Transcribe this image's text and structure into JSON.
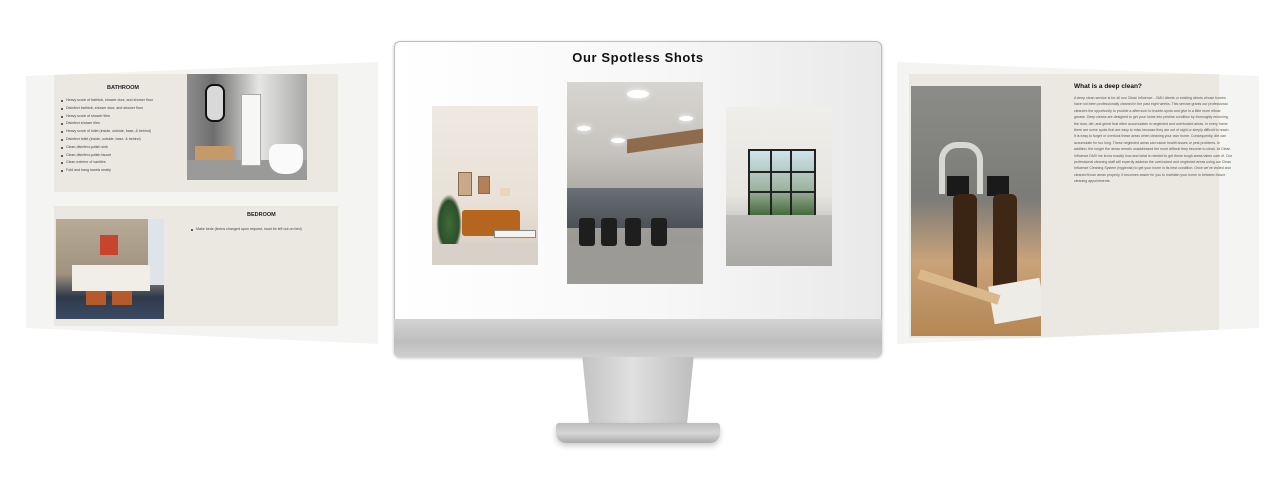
{
  "left_panel": {
    "bathroom": {
      "title": "BATHROOM",
      "items": [
        "Heavy scrub of bathtub, shower door, and shower floor",
        "Disinfect bathtub, shower door, and shower floor",
        "Heavy scrub of shower tiles",
        "Disinfect shower tiles",
        "Heavy scrub of toilet (inside, outside, base, & behind)",
        "Disinfect toilet (inside, outside, base, & behind)",
        "Clean-disinfect-polish sink",
        "Clean-disinfect-polish faucet",
        "Clean exterior of vanities",
        "Fold and hang towels neatly"
      ]
    },
    "bedroom": {
      "title": "BEDROOM",
      "items": [
        "Make beds (linens changed upon request, must be left out on bed)"
      ]
    }
  },
  "monitor": {
    "title": "Our Spotless Shots"
  },
  "right_panel": {
    "heading": "What is a deep clean?",
    "body": "A deep clean service is for all non Clean Influence - CMU clients or existing clients whose homes have not been professionally cleaned in the past eight weeks. This service grants our professional cleaners the opportunity to provide a afternoon to trouble-spots and give in a little more elbow grease. Deep cleans are designed to get your home into pristine condition by thoroughly removing the dust, dirt, and grime that often accumulates in neglected and overlooked areas. In every home there are some spots that are easy to miss because they are out of sight or simply difficult to reach. It is easy to forget or overlook these areas when cleaning your own home. Consequently, dirt can accumulate for too long. These neglected areas can cause health issues or pest problems. In addition, the longer the areas remain unaddressed the more difficult they become to clean. At Clean Influence DMV we know exactly how and what is needed to get these tough areas taken care of. Our professional cleaning staff will expertly address the overlooked and neglected areas using our Clean Influence Cleaning System (hygienist) to get your home in its best condition. Once we've visited and cleaned those areas properly, it becomes easier for you to maintain your home in between future cleaning appointments."
  }
}
